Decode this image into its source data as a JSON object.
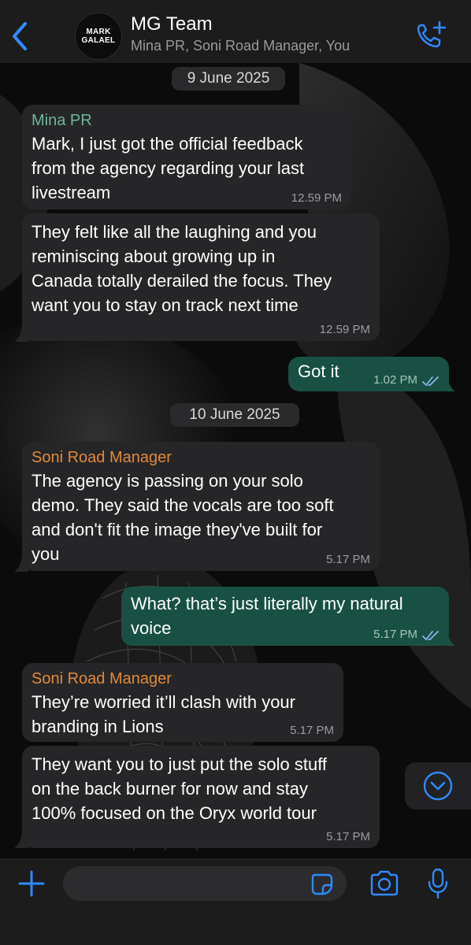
{
  "header": {
    "avatar_text_line1": "MARK",
    "avatar_text_line2": "GALAEL",
    "title": "MG Team",
    "members": "Mina PR, Soni Road Manager, You",
    "back_icon": "chevron-left-icon",
    "call_icon": "phone-plus-icon"
  },
  "colors": {
    "accent": "#2f8bff",
    "outgoing_bubble": "#185144",
    "incoming_bubble": "#262628",
    "mina_name": "#6fb59c",
    "soni_name": "#e18a3b"
  },
  "dates": [
    "9 June 2025",
    "10 June 2025"
  ],
  "messages": [
    {
      "sender": "Mina PR",
      "text": "Mark, I just got the official feedback\nfrom the agency regarding your last\nlivestream",
      "time": "12.59 PM"
    },
    {
      "text": "They felt like all the laughing and you\nreminiscing about growing up in\nCanada totally derailed the focus. They\nwant you to stay on track next time",
      "time": "12.59 PM"
    },
    {
      "text": "Got it",
      "time": "1.02 PM",
      "outgoing": true
    },
    {
      "sender": "Soni Road Manager",
      "text": "The agency is passing on your solo\ndemo. They said the vocals are too soft\nand don't fit the image they've built for\nyou",
      "time": "5.17 PM"
    },
    {
      "text": "What? that’s just literally my natural\nvoice",
      "time": "5.17 PM",
      "outgoing": true
    },
    {
      "sender": "Soni Road Manager",
      "text": "They’re worried it’ll clash with your\nbranding in Lions",
      "time": "5.17 PM"
    },
    {
      "text": "They want you to just put the solo stuff\non the back burner for now and stay\n100% focused on the Oryx world tour",
      "time": "5.17 PM"
    }
  ],
  "composer": {
    "placeholder": "",
    "icons": [
      "plus-icon",
      "sticker-icon",
      "camera-icon",
      "microphone-icon"
    ]
  }
}
